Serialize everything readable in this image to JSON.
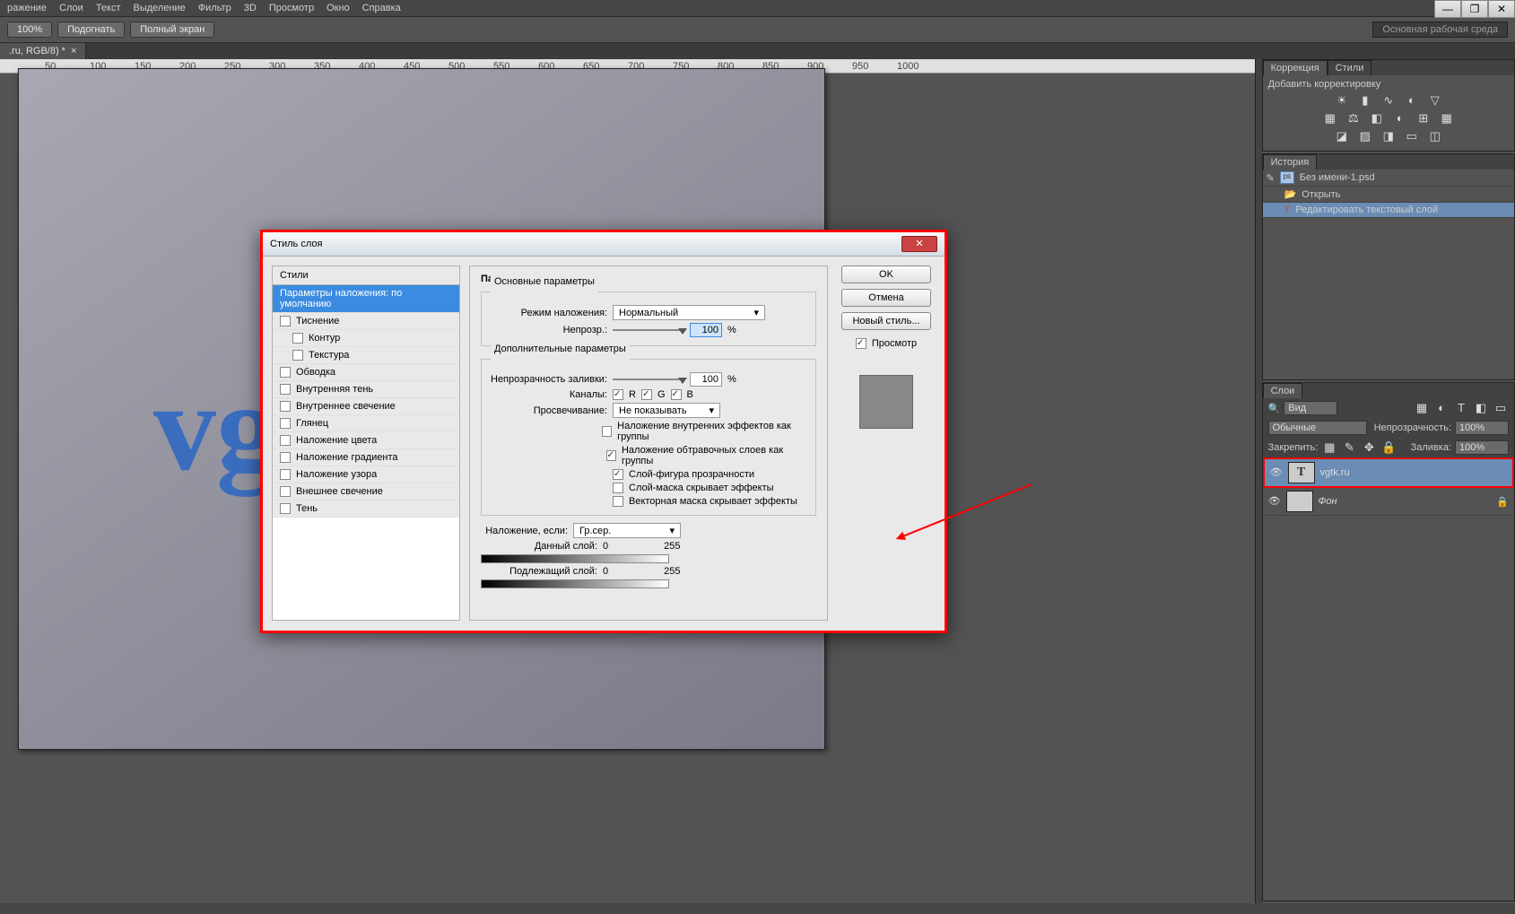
{
  "menubar": {
    "items": [
      "ражение",
      "Слои",
      "Текст",
      "Выделение",
      "Фильтр",
      "3D",
      "Просмотр",
      "Окно",
      "Справка"
    ]
  },
  "options": {
    "zoom": "100%",
    "fit": "Подогнать",
    "full": "Полный экран",
    "workspace": "Основная рабочая среда"
  },
  "doc": {
    "tab": ".ru, RGB/8) *",
    "canvas_text": "vg"
  },
  "ruler": {
    "marks": [
      "50",
      "100",
      "150",
      "200",
      "250",
      "300",
      "350",
      "400",
      "450",
      "500",
      "550",
      "600",
      "650",
      "700",
      "750",
      "800",
      "850",
      "900",
      "950",
      "1000"
    ]
  },
  "dialog": {
    "title": "Стиль слоя",
    "styles_header": "Стили",
    "styles": [
      {
        "label": "Параметры наложения: по умолчанию",
        "sel": true,
        "cb": false,
        "chk": false
      },
      {
        "label": "Тиснение",
        "cb": true,
        "chk": false
      },
      {
        "label": "Контур",
        "cb": true,
        "chk": false,
        "indent": true
      },
      {
        "label": "Текстура",
        "cb": true,
        "chk": false,
        "indent": true
      },
      {
        "label": "Обводка",
        "cb": true,
        "chk": false
      },
      {
        "label": "Внутренняя тень",
        "cb": true,
        "chk": false
      },
      {
        "label": "Внутреннее свечение",
        "cb": true,
        "chk": false
      },
      {
        "label": "Глянец",
        "cb": true,
        "chk": false
      },
      {
        "label": "Наложение цвета",
        "cb": true,
        "chk": false
      },
      {
        "label": "Наложение градиента",
        "cb": true,
        "chk": false
      },
      {
        "label": "Наложение узора",
        "cb": true,
        "chk": false
      },
      {
        "label": "Внешнее свечение",
        "cb": true,
        "chk": false
      },
      {
        "label": "Тень",
        "cb": true,
        "chk": false
      }
    ],
    "params_title": "Параметры наложения",
    "grp_basic": "Основные параметры",
    "blend_label": "Режим наложения:",
    "blend_value": "Нормальный",
    "opacity_label": "Непрозр.:",
    "opacity": "100",
    "pct": "%",
    "grp_adv": "Дополнительные параметры",
    "fill_label": "Непрозрачность заливки:",
    "fill": "100",
    "channels_label": "Каналы:",
    "ch_r": "R",
    "ch_g": "G",
    "ch_b": "B",
    "knockout_label": "Просвечивание:",
    "knockout": "Не показывать",
    "ck1": "Наложение внутренних эффектов как группы",
    "ck2": "Наложение обтравочных слоев как группы",
    "ck3": "Слой-фигура прозрачности",
    "ck4": "Слой-маска скрывает эффекты",
    "ck5": "Векторная маска скрывает эффекты",
    "blendif_label": "Наложение, если:",
    "blendif": "Гр.сер.",
    "this_label": "Данный слой:",
    "this_lo": "0",
    "this_hi": "255",
    "under_label": "Подлежащий слой:",
    "under_lo": "0",
    "under_hi": "255",
    "btn_ok": "OK",
    "btn_cancel": "Отмена",
    "btn_new": "Новый стиль...",
    "preview": "Просмотр"
  },
  "panels": {
    "corr": {
      "tab": "Коррекция",
      "tab2": "Стили",
      "add": "Добавить корректировку"
    },
    "hist": {
      "tab": "История",
      "file": "Без имени-1.psd",
      "open": "Открыть",
      "edit": "Редактировать текстовый слой"
    },
    "layers": {
      "tab": "Слои",
      "kind": "Вид",
      "blend": "Обычные",
      "opacity_lbl": "Непрозрачность:",
      "opacity": "100%",
      "lock": "Закрепить:",
      "fill_lbl": "Заливка:",
      "fill": "100%",
      "layer_text": "vgtk.ru",
      "layer_bg": "Фон"
    }
  }
}
